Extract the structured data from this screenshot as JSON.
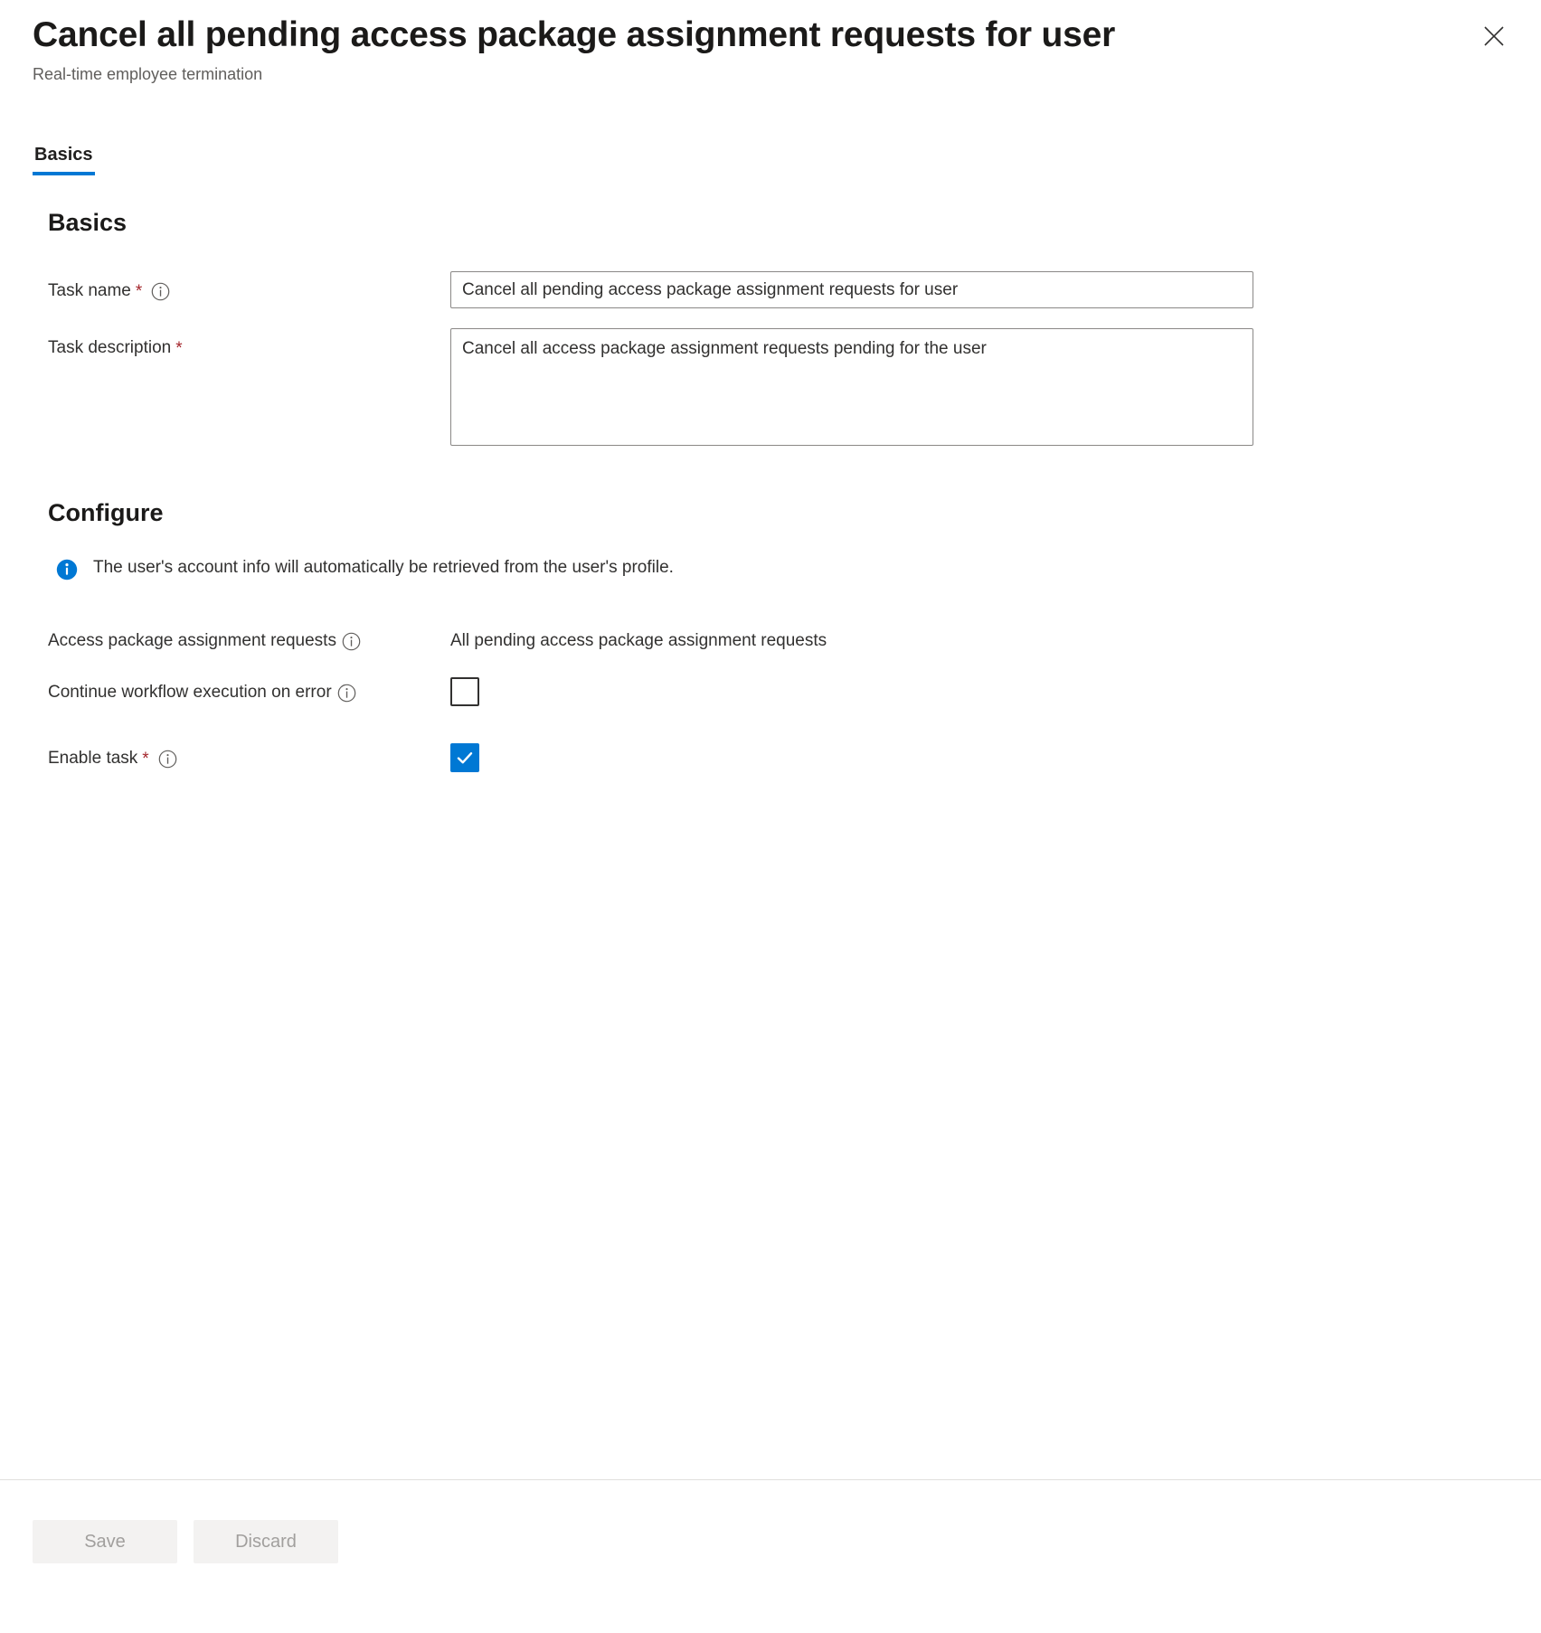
{
  "header": {
    "title": "Cancel all pending access package assignment requests for user",
    "subtitle": "Real-time employee termination",
    "close_label": "Close",
    "close_icon": "close-icon"
  },
  "tabs": [
    {
      "label": "Basics",
      "active": true
    }
  ],
  "sections": {
    "basics": {
      "heading": "Basics",
      "task_name": {
        "label": "Task name",
        "required_marker": "*",
        "info_icon": "info-icon",
        "value": "Cancel all pending access package assignment requests for user",
        "placeholder": ""
      },
      "task_description": {
        "label": "Task description",
        "required_marker": "*",
        "value": "Cancel all access package assignment requests pending for the user",
        "placeholder": ""
      }
    },
    "configure": {
      "heading": "Configure",
      "banner": {
        "icon": "info-filled-icon",
        "text": "The user's account info will automatically be retrieved from the user's profile.",
        "accent_color": "#0078d4"
      },
      "access_package_requests": {
        "label": "Access package assignment requests",
        "info_icon": "info-icon",
        "value": "All pending access package assignment requests"
      },
      "continue_on_error": {
        "label": "Continue workflow execution on error",
        "info_icon": "info-icon",
        "checked": false
      },
      "enable_task": {
        "label": "Enable task",
        "required_marker": "*",
        "info_icon": "info-icon",
        "checked": true
      }
    }
  },
  "footer": {
    "save_label": "Save",
    "discard_label": "Discard",
    "save_disabled": true,
    "discard_disabled": true
  },
  "colors": {
    "accent": "#0078d4",
    "required": "#a4262c",
    "text": "#323130",
    "muted": "#605e5c",
    "disabled_text": "#a19f9d",
    "disabled_bg": "#f3f2f1",
    "border": "#8a8886"
  }
}
